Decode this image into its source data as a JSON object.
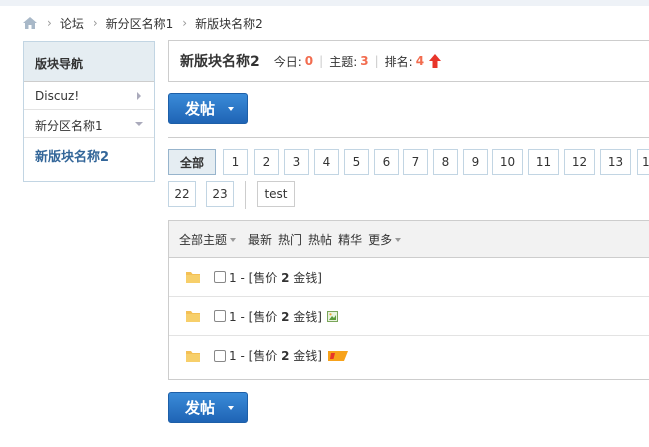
{
  "breadcrumb": {
    "items": [
      "论坛",
      "新分区名称1",
      "新版块名称2"
    ]
  },
  "sidebar": {
    "title": "版块导航",
    "items": [
      {
        "label": "Discuz!"
      },
      {
        "label": "新分区名称1"
      },
      {
        "label": "新版块名称2"
      }
    ]
  },
  "forum": {
    "name": "新版块名称2",
    "today_label": "今日:",
    "today_value": "0",
    "topics_label": "主题:",
    "topics_value": "3",
    "rank_label": "排名:",
    "rank_value": "4"
  },
  "post_button": {
    "label": "发帖"
  },
  "pages": [
    "全部",
    "1",
    "2",
    "3",
    "4",
    "5",
    "6",
    "7",
    "8",
    "9",
    "10",
    "11",
    "12",
    "13",
    "1",
    "22",
    "23",
    "test"
  ],
  "tabs": {
    "all": "全部主题",
    "latest": "最新",
    "hot": "热门",
    "hotposts": "热帖",
    "digest": "精华",
    "more": "更多"
  },
  "threads": [
    {
      "prefix": "1 - [售价 ",
      "price": "2",
      "suffix": " 金钱]"
    },
    {
      "prefix": "1 - [售价 ",
      "price": "2",
      "suffix": " 金钱]"
    },
    {
      "prefix": "1 - [售价 ",
      "price": "2",
      "suffix": " 金钱]"
    }
  ],
  "colors": {
    "accent_blue": "#1f64b5",
    "stat_red": "#f26c4f",
    "link_blue": "#336699"
  }
}
